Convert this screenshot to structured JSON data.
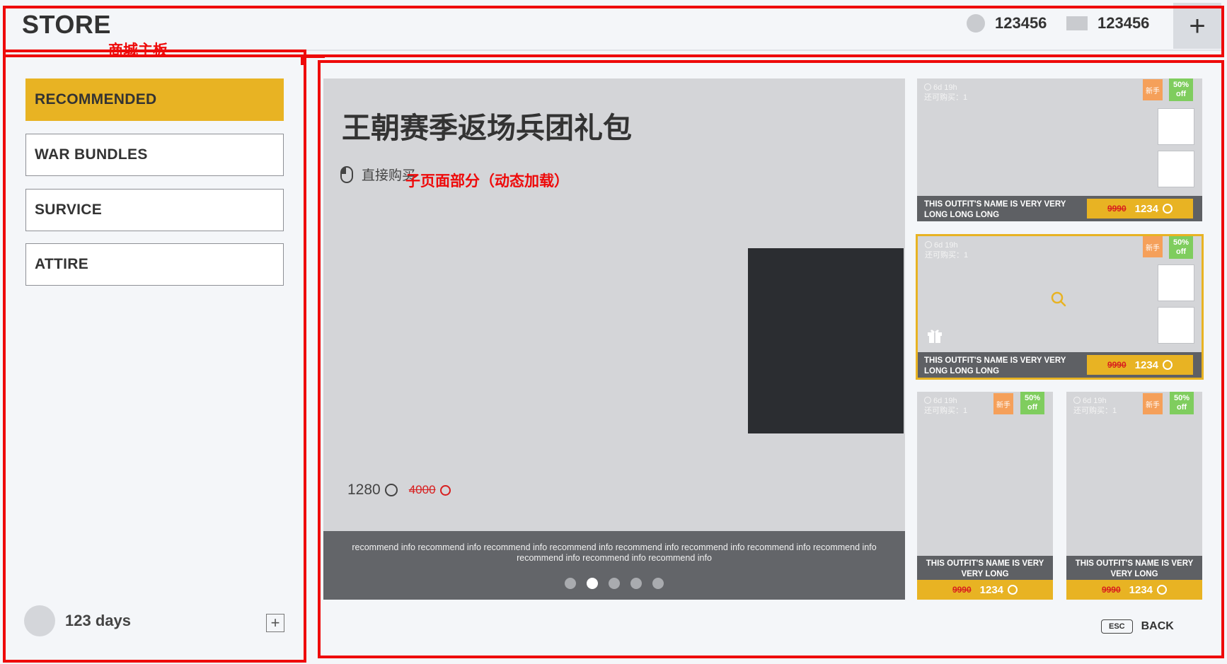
{
  "header": {
    "title": "STORE",
    "currencies": [
      {
        "icon": "coin-icon",
        "amount": "123456"
      },
      {
        "icon": "gem-icon",
        "amount": "123456"
      }
    ],
    "add_label": "+"
  },
  "annotations": {
    "main_panel": "商城主板",
    "sub_page": "子页面部分（动态加载）"
  },
  "sidebar": {
    "items": [
      {
        "label": "RECOMMENDED",
        "active": true
      },
      {
        "label": "WAR BUNDLES",
        "active": false
      },
      {
        "label": "SURVICE",
        "active": false
      },
      {
        "label": "ATTIRE",
        "active": false
      }
    ],
    "days": "123 days",
    "expand_label": "+"
  },
  "banner": {
    "title": "王朝赛季返场兵团礼包",
    "purchase_label": "直接购买",
    "price": "1280",
    "old_price": "4000",
    "info": "recommend info recommend info recommend info recommend info recommend info recommend info recommend info recommend info recommend info recommend info recommend info",
    "dots": 5,
    "active_dot": 1
  },
  "cards": [
    {
      "timer": "6d 19h",
      "limit": "还可购买：1",
      "badge_new": "新手",
      "badge_off_top": "50%",
      "badge_off_bottom": "off",
      "name": "THIS OUTFIT'S NAME IS VERY VERY LONG LONG LONG",
      "old_price": "9990",
      "price": "1234"
    },
    {
      "timer": "6d 19h",
      "limit": "还可购买：1",
      "badge_new": "新手",
      "badge_off_top": "50%",
      "badge_off_bottom": "off",
      "name": "THIS OUTFIT'S NAME IS VERY VERY LONG LONG LONG",
      "old_price": "9990",
      "price": "1234"
    },
    {
      "timer": "6d 19h",
      "limit": "还可购买：1",
      "badge_new": "新手",
      "badge_off_top": "50%",
      "badge_off_bottom": "off",
      "name": "THIS OUTFIT'S NAME IS VERY VERY LONG",
      "old_price": "9990",
      "price": "1234"
    },
    {
      "timer": "6d 19h",
      "limit": "还可购买：1",
      "badge_new": "新手",
      "badge_off_top": "50%",
      "badge_off_bottom": "off",
      "name": "THIS OUTFIT'S NAME IS VERY VERY LONG",
      "old_price": "9990",
      "price": "1234"
    }
  ],
  "back": {
    "key": "ESC",
    "label": "BACK"
  },
  "colors": {
    "accent": "#e8b323",
    "annotation": "#ee0a0a",
    "discount": "#7fcd5e",
    "new_badge": "#f5a05a",
    "strike": "#d81e1e"
  }
}
